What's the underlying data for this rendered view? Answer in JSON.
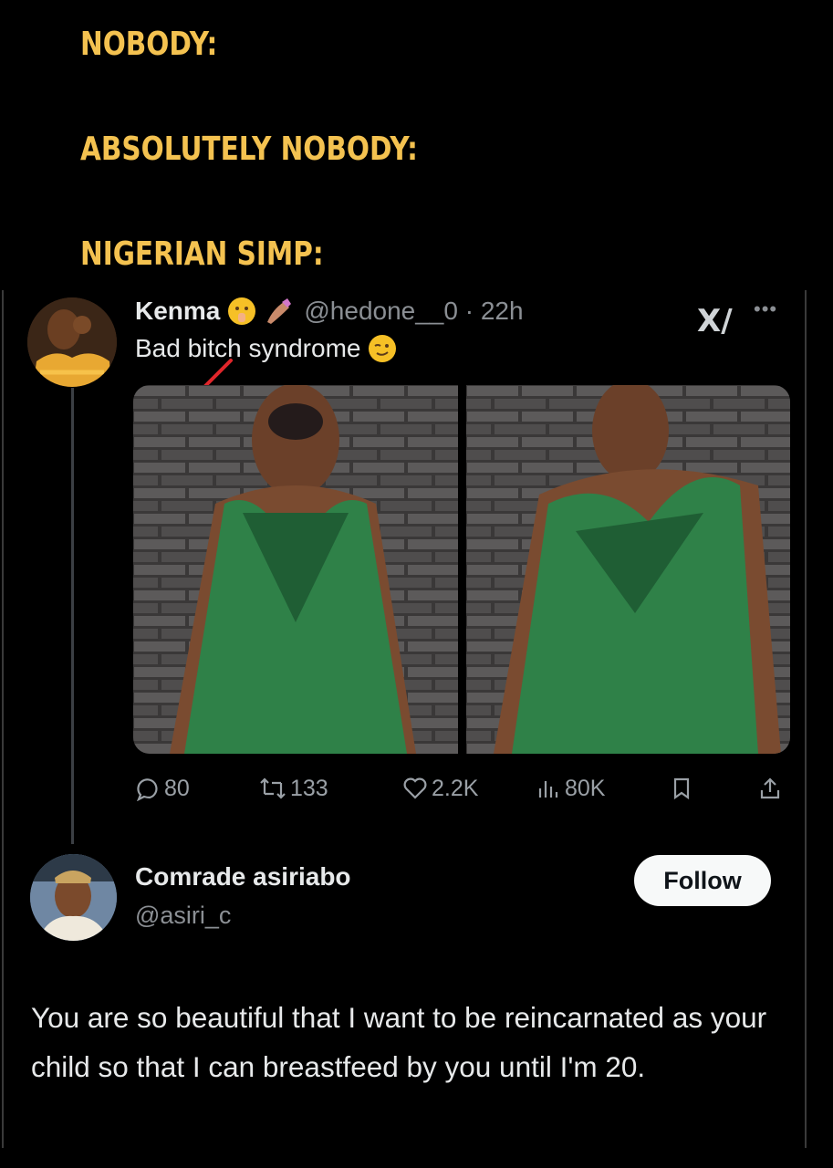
{
  "meme": {
    "line1": "NOBODY:",
    "line2": "ABSOLUTELY NOBODY:",
    "line3": "NIGERIAN SIMP:",
    "text_color": "#f4c250"
  },
  "tweet": {
    "author_name": "Kenma",
    "handle_time": "@hedone__0 · 22h",
    "text": "Bad bitch syndrome",
    "stats": {
      "replies": "80",
      "retweets": "133",
      "likes": "2.2K",
      "views": "80K"
    },
    "icons": [
      "grok-icon",
      "more-icon",
      "reply-icon",
      "retweet-icon",
      "heart-icon",
      "views-icon",
      "bookmark-icon",
      "share-icon"
    ]
  },
  "reply": {
    "author_name": "Comrade asiriabo",
    "handle": "@asiri_c",
    "follow_label": "Follow",
    "text": "You are so beautiful that I want to be reincarnated as your child so that I can breastfeed by you until I'm 20."
  },
  "colors": {
    "background": "#000000",
    "text": "#e7e9ea",
    "secondary_text": "#8b8f94",
    "follow_button_bg": "#f7f9f9"
  }
}
